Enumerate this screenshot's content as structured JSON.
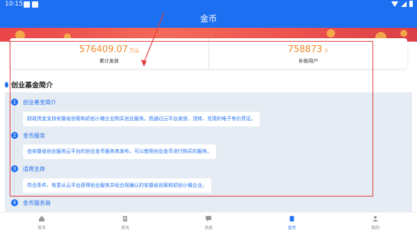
{
  "status_bar": {
    "time": "10:15"
  },
  "app_bar": {
    "title": "金币"
  },
  "stats": {
    "total_issued": {
      "value": "576409.07",
      "unit": "万元",
      "label": "累计发放"
    },
    "subsidized_users": {
      "value": "758873",
      "unit": "人",
      "label": "补助用户"
    }
  },
  "section": {
    "title": "创业基金简介",
    "items": [
      {
        "num": "1",
        "title": "创业基金简介",
        "desc": "财政资金支持安徽省创客和初创小微企业购买创业服务。而通过云平台发放、流转、兑现的电子有价凭证。"
      },
      {
        "num": "2",
        "title": "金币服务",
        "desc": "由安徽省创业服务云平台的创业金币服务商发布，可以使用创业金币进行购买的服务。"
      },
      {
        "num": "3",
        "title": "适用主体",
        "desc": "符合条件、有意从云平台获得创业服务并经合规确认的安徽省创客和初创小微企业。"
      },
      {
        "num": "4",
        "title": "金币服务商"
      }
    ]
  },
  "bottom_nav": [
    {
      "label": "首页",
      "icon": "home-icon",
      "active": false
    },
    {
      "label": "资讯",
      "icon": "news-icon",
      "active": false
    },
    {
      "label": "消息",
      "icon": "message-icon",
      "active": false
    },
    {
      "label": "金币",
      "icon": "coins-icon",
      "active": true
    },
    {
      "label": "我的",
      "icon": "user-icon",
      "active": false
    }
  ],
  "colors": {
    "primary": "#1d6ff2",
    "accent_orange": "#f08a2c",
    "annotation_red": "#e03a3a"
  }
}
